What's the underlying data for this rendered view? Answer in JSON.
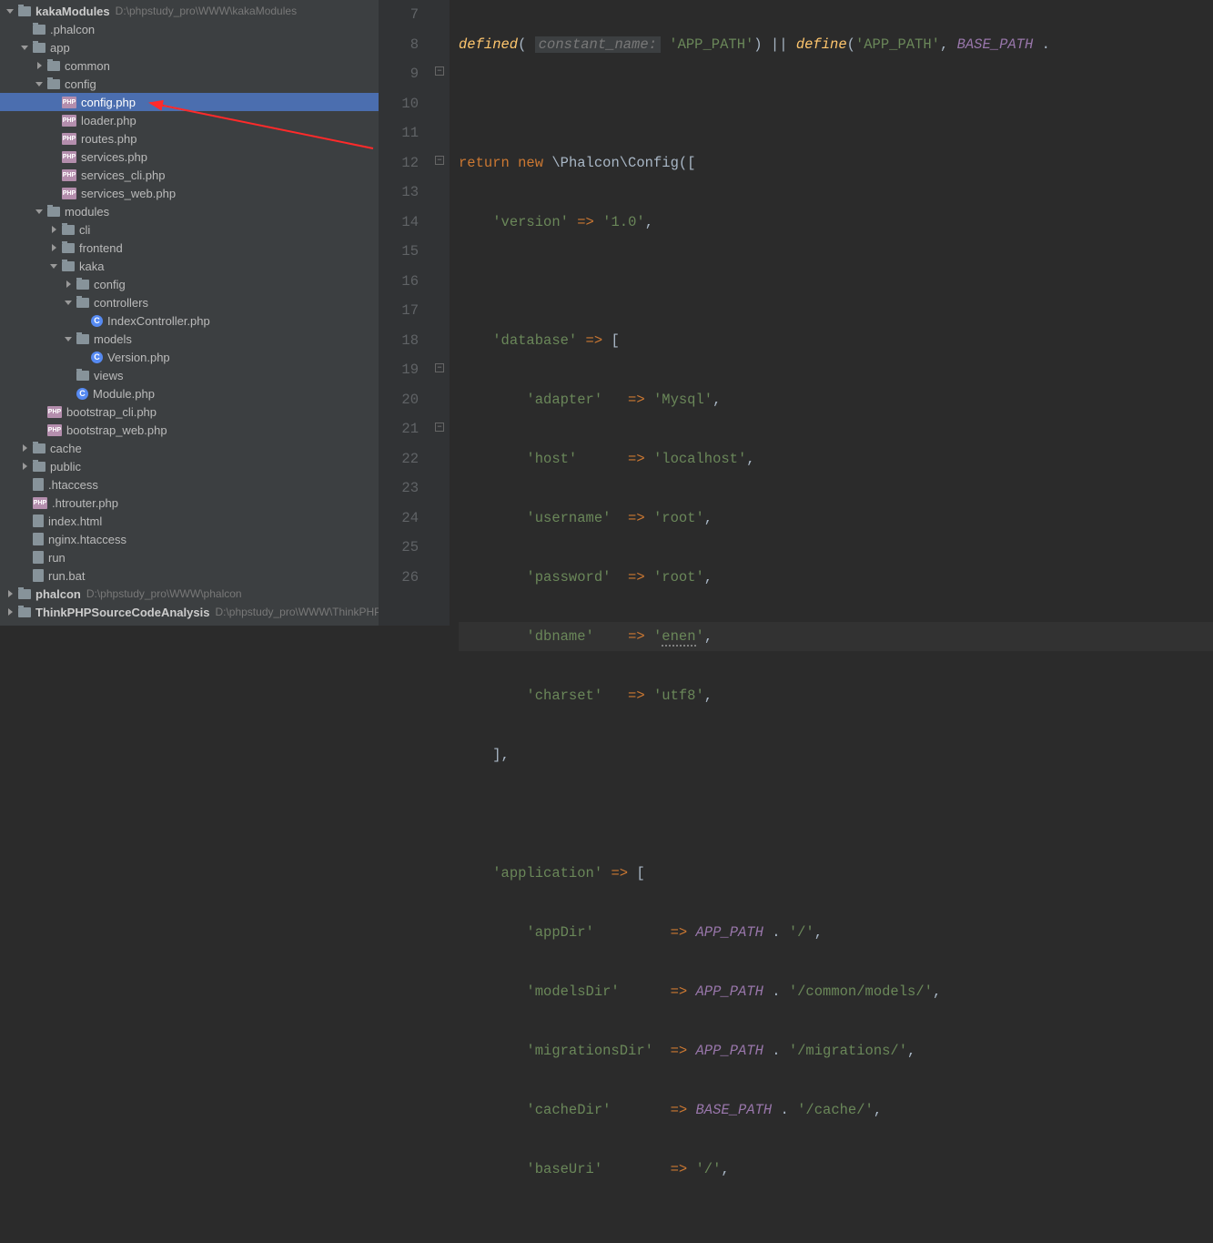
{
  "project": {
    "root_name": "kakaModules",
    "root_path": "D:\\phpstudy_pro\\WWW\\kakaModules",
    "nodes": [
      {
        "indent": 0,
        "arrow": "open",
        "icon": "folder",
        "label": "kakaModules",
        "bold": true,
        "path": "D:\\phpstudy_pro\\WWW\\kakaModules"
      },
      {
        "indent": 1,
        "arrow": "none",
        "icon": "folder",
        "label": ".phalcon"
      },
      {
        "indent": 1,
        "arrow": "open",
        "icon": "folder",
        "label": "app"
      },
      {
        "indent": 2,
        "arrow": "closed",
        "icon": "folder",
        "label": "common"
      },
      {
        "indent": 2,
        "arrow": "open",
        "icon": "folder",
        "label": "config"
      },
      {
        "indent": 3,
        "arrow": "none",
        "icon": "php-file",
        "label": "config.php",
        "selected": true
      },
      {
        "indent": 3,
        "arrow": "none",
        "icon": "php-file",
        "label": "loader.php"
      },
      {
        "indent": 3,
        "arrow": "none",
        "icon": "php-file",
        "label": "routes.php"
      },
      {
        "indent": 3,
        "arrow": "none",
        "icon": "php-file",
        "label": "services.php"
      },
      {
        "indent": 3,
        "arrow": "none",
        "icon": "php-file",
        "label": "services_cli.php"
      },
      {
        "indent": 3,
        "arrow": "none",
        "icon": "php-file",
        "label": "services_web.php"
      },
      {
        "indent": 2,
        "arrow": "open",
        "icon": "folder",
        "label": "modules"
      },
      {
        "indent": 3,
        "arrow": "closed",
        "icon": "folder",
        "label": "cli"
      },
      {
        "indent": 3,
        "arrow": "closed",
        "icon": "folder",
        "label": "frontend"
      },
      {
        "indent": 3,
        "arrow": "open",
        "icon": "folder",
        "label": "kaka"
      },
      {
        "indent": 4,
        "arrow": "closed",
        "icon": "folder",
        "label": "config"
      },
      {
        "indent": 4,
        "arrow": "open",
        "icon": "folder",
        "label": "controllers"
      },
      {
        "indent": 5,
        "arrow": "none",
        "icon": "class-file",
        "label": "IndexController.php"
      },
      {
        "indent": 4,
        "arrow": "open",
        "icon": "folder",
        "label": "models"
      },
      {
        "indent": 5,
        "arrow": "none",
        "icon": "class-file",
        "label": "Version.php"
      },
      {
        "indent": 4,
        "arrow": "none",
        "icon": "folder",
        "label": "views"
      },
      {
        "indent": 4,
        "arrow": "none",
        "icon": "class-file",
        "label": "Module.php"
      },
      {
        "indent": 2,
        "arrow": "none",
        "icon": "php-file",
        "label": "bootstrap_cli.php"
      },
      {
        "indent": 2,
        "arrow": "none",
        "icon": "php-file",
        "label": "bootstrap_web.php"
      },
      {
        "indent": 1,
        "arrow": "closed",
        "icon": "folder",
        "label": "cache"
      },
      {
        "indent": 1,
        "arrow": "closed",
        "icon": "folder",
        "label": "public"
      },
      {
        "indent": 1,
        "arrow": "none",
        "icon": "generic-file",
        "label": ".htaccess"
      },
      {
        "indent": 1,
        "arrow": "none",
        "icon": "php-file",
        "label": ".htrouter.php"
      },
      {
        "indent": 1,
        "arrow": "none",
        "icon": "generic-file",
        "label": "index.html"
      },
      {
        "indent": 1,
        "arrow": "none",
        "icon": "generic-file",
        "label": "nginx.htaccess"
      },
      {
        "indent": 1,
        "arrow": "none",
        "icon": "generic-file",
        "label": "run"
      },
      {
        "indent": 1,
        "arrow": "none",
        "icon": "generic-file",
        "label": "run.bat"
      },
      {
        "indent": 0,
        "arrow": "closed",
        "icon": "folder",
        "label": "phalcon",
        "bold": true,
        "path": "D:\\phpstudy_pro\\WWW\\phalcon"
      },
      {
        "indent": 0,
        "arrow": "closed",
        "icon": "folder",
        "label": "ThinkPHPSourceCodeAnalysis",
        "bold": true,
        "path": "D:\\phpstudy_pro\\WWW\\ThinkPHP"
      }
    ]
  },
  "editor": {
    "line_numbers": [
      "7",
      "8",
      "9",
      "10",
      "11",
      "12",
      "13",
      "14",
      "15",
      "16",
      "17",
      "18",
      "19",
      "20",
      "21",
      "22",
      "23",
      "24",
      "25",
      "26"
    ],
    "highlighted_line_index": 10,
    "hint_constant_name": "constant_name:",
    "tokens": {
      "defined": "defined",
      "define": "define",
      "app_path": "'APP_PATH'",
      "base_path": "BASE_PATH",
      "return": "return",
      "new": "new",
      "phalcon_config": "\\Phalcon\\Config",
      "version_k": "'version'",
      "version_v": "'1.0'",
      "database_k": "'database'",
      "adapter_k": "'adapter'",
      "adapter_v": "'Mysql'",
      "host_k": "'host'",
      "host_v": "'localhost'",
      "username_k": "'username'",
      "username_v": "'root'",
      "password_k": "'password'",
      "password_v": "'root'",
      "dbname_k": "'dbname'",
      "dbname_v": "'enen'",
      "charset_k": "'charset'",
      "charset_v": "'utf8'",
      "application_k": "'application'",
      "appdir_k": "'appDir'",
      "modelsdir_k": "'modelsDir'",
      "migrationsdir_k": "'migrationsDir'",
      "cachedir_k": "'cacheDir'",
      "baseuri_k": "'baseUri'",
      "app_path_const": "APP_PATH",
      "base_path_const": "BASE_PATH",
      "slash": "'/'",
      "models_path": "'/common/models/'",
      "migrations_path": "'/migrations/'",
      "cache_path": "'/cache/'"
    }
  }
}
